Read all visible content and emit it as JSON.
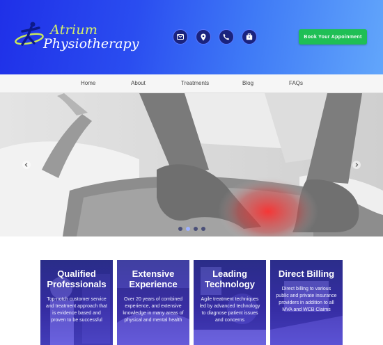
{
  "header": {
    "logo_line1": "Atrium",
    "logo_line2": "Physiotherapy",
    "icons": [
      "email-icon",
      "location-pin-icon",
      "phone-icon",
      "briefcase-icon"
    ],
    "book_button": "Book Your Appoinment",
    "colors": {
      "gradient_start": "#1f30e8",
      "gradient_end": "#62a6fb",
      "button": "#1fbf55"
    }
  },
  "nav": {
    "items": [
      "Home",
      "About",
      "Treatments",
      "Blog",
      "FAQs"
    ]
  },
  "hero": {
    "slides": 4,
    "active_slide": 2
  },
  "features": [
    {
      "title_1": "Qualified",
      "title_2": "Professionals",
      "text": "Top-notch customer service and treatment approach that is evidence based and proven to be successful"
    },
    {
      "title_1": "Extensive",
      "title_2": "Experience",
      "text": "Over 20 years of combined experience, and extensive knowledge in many areas of physical and mental health"
    },
    {
      "title_1": "Leading",
      "title_2": "Technology",
      "text": "Agile treatment techniques led by advanced technology to diagnose patient issues and concerns"
    },
    {
      "title_1": "Direct Billing",
      "title_2": "",
      "text": "Direct billing to various public and private insurance providers in addition to all MVA and WCB Claims"
    }
  ]
}
